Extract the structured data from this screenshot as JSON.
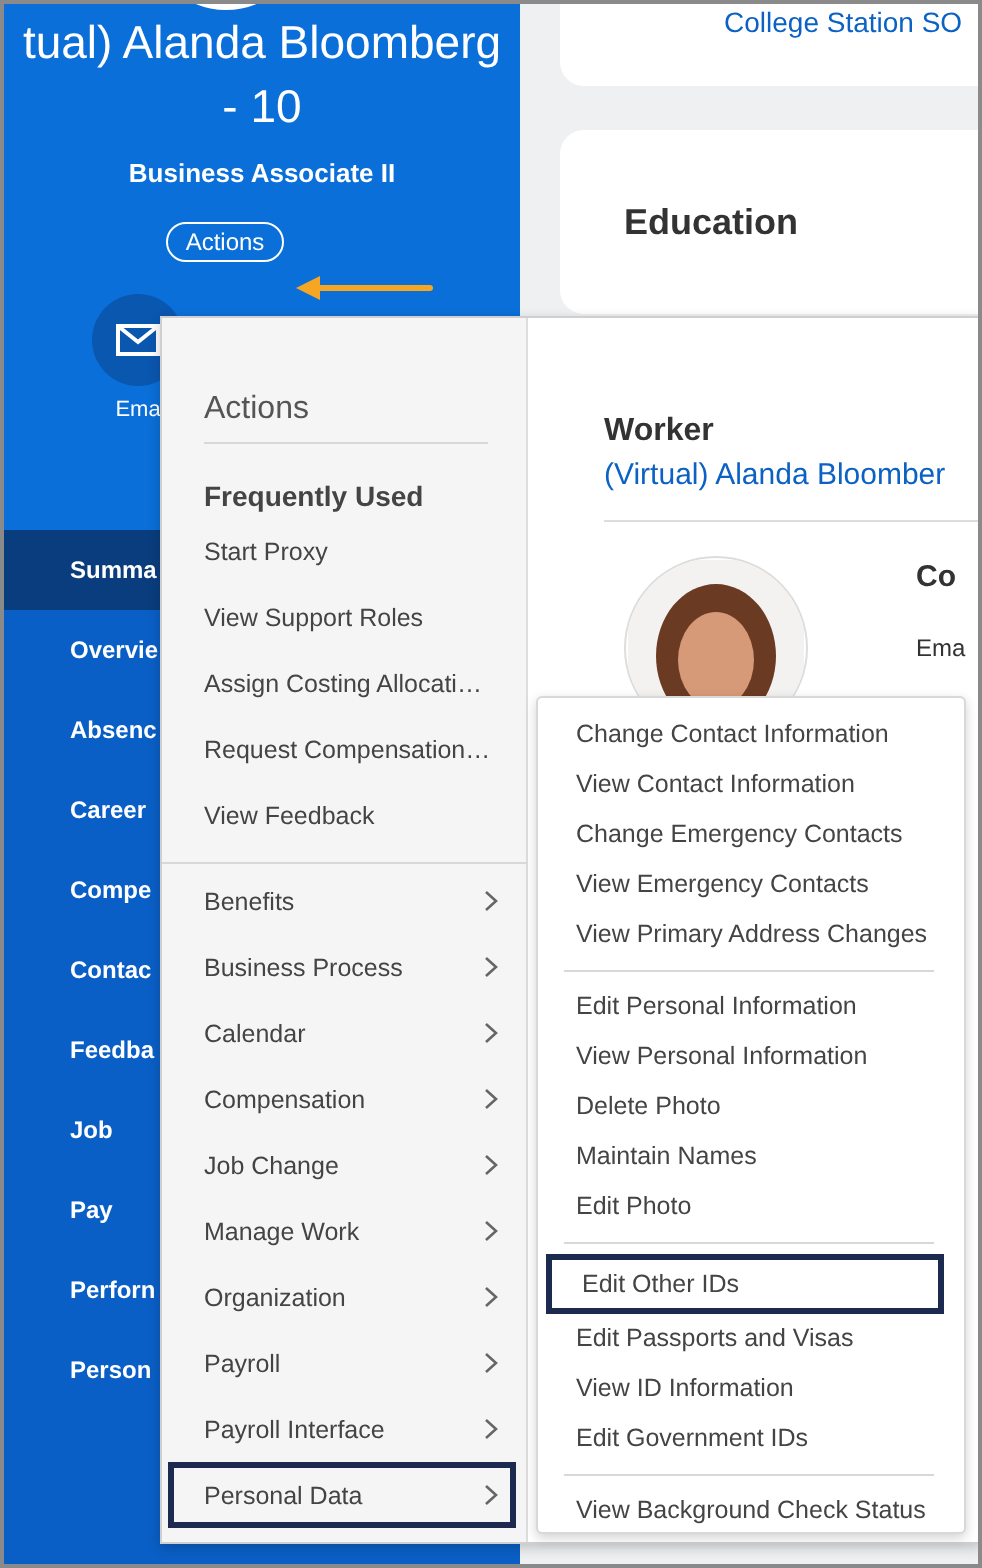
{
  "profile": {
    "name": "tual) Alanda Bloomberg",
    "name_suffix": "- 10",
    "title": "Business Associate II",
    "actions_button": "Actions",
    "email_label": "Ema"
  },
  "nav": [
    {
      "label": "Summa",
      "selected": true
    },
    {
      "label": "Overvie",
      "selected": false
    },
    {
      "label": "Absenc",
      "selected": false
    },
    {
      "label": "Career",
      "selected": false
    },
    {
      "label": "Compe",
      "selected": false
    },
    {
      "label": "Contac",
      "selected": false
    },
    {
      "label": "Feedba",
      "selected": false
    },
    {
      "label": "Job",
      "selected": false
    },
    {
      "label": "Pay",
      "selected": false
    },
    {
      "label": "Perforn",
      "selected": false
    },
    {
      "label": "Person",
      "selected": false
    }
  ],
  "cards": {
    "top_link": "College Station SO",
    "education_title": "Education"
  },
  "actions_menu": {
    "title": "Actions",
    "frequent_heading": "Frequently Used",
    "frequent": [
      "Start Proxy",
      "View Support Roles",
      "Assign Costing Allocati…",
      "Request Compensation…",
      "View Feedback"
    ],
    "categories": [
      {
        "label": "Benefits",
        "selected": false
      },
      {
        "label": "Business Process",
        "selected": false
      },
      {
        "label": "Calendar",
        "selected": false
      },
      {
        "label": "Compensation",
        "selected": false
      },
      {
        "label": "Job Change",
        "selected": false
      },
      {
        "label": "Manage Work",
        "selected": false
      },
      {
        "label": "Organization",
        "selected": false
      },
      {
        "label": "Payroll",
        "selected": false
      },
      {
        "label": "Payroll Interface",
        "selected": false
      },
      {
        "label": "Personal Data",
        "selected": true
      }
    ],
    "preview": {
      "heading": "Worker",
      "worker_link": "(Virtual) Alanda Bloomber",
      "contact_heading": "Co",
      "email_label": "Ema"
    }
  },
  "submenu": {
    "groups": [
      {
        "items": [
          {
            "label": "Change Contact Information",
            "selected": false
          },
          {
            "label": "View Contact Information",
            "selected": false
          },
          {
            "label": "Change Emergency Contacts",
            "selected": false
          },
          {
            "label": "View Emergency Contacts",
            "selected": false
          },
          {
            "label": "View Primary Address Changes",
            "selected": false
          }
        ]
      },
      {
        "items": [
          {
            "label": "Edit Personal Information",
            "selected": false
          },
          {
            "label": "View Personal Information",
            "selected": false
          },
          {
            "label": "Delete Photo",
            "selected": false
          },
          {
            "label": "Maintain Names",
            "selected": false
          },
          {
            "label": "Edit Photo",
            "selected": false
          }
        ]
      },
      {
        "items": [
          {
            "label": "Edit Other IDs",
            "selected": true
          },
          {
            "label": "Edit Passports and Visas",
            "selected": false
          },
          {
            "label": "View ID Information",
            "selected": false
          },
          {
            "label": "Edit Government IDs",
            "selected": false
          }
        ]
      },
      {
        "items": [
          {
            "label": "View Background Check Status",
            "selected": false
          }
        ]
      }
    ]
  }
}
